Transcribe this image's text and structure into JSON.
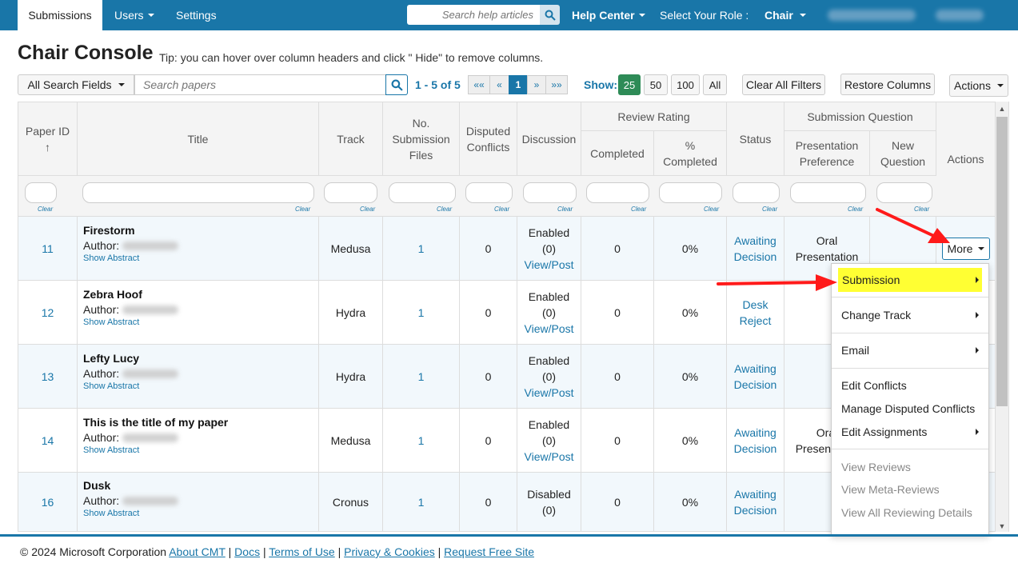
{
  "navbar": {
    "tabs": [
      "Submissions",
      "Users",
      "Settings"
    ],
    "help_search_placeholder": "Search help articles",
    "help_center": "Help Center",
    "role_label": "Select Your Role :",
    "role_value": "Chair"
  },
  "header": {
    "title": "Chair Console",
    "tip": "Tip: you can hover over column headers and click \" Hide\" to remove columns."
  },
  "toolbar": {
    "search_fields": "All Search Fields",
    "search_placeholder": "Search papers",
    "range": "1 - 5 of 5",
    "pager": [
      "««",
      "«",
      "1",
      "»",
      "»»"
    ],
    "show_label": "Show:",
    "show_options": [
      "25",
      "50",
      "100",
      "All"
    ],
    "clear_filters": "Clear All Filters",
    "restore_columns": "Restore Columns",
    "actions": "Actions"
  },
  "table": {
    "headers": {
      "paper_id": "Paper ID",
      "sort_indicator": "↑",
      "title": "Title",
      "track": "Track",
      "num_files": "No. Submission Files",
      "disputed": "Disputed Conflicts",
      "discussion": "Discussion",
      "review_rating": "Review Rating",
      "completed": "Completed",
      "pct_completed": "% Completed",
      "status": "Status",
      "submission_question": "Submission Question",
      "presentation_pref": "Presentation Preference",
      "new_question": "New Question",
      "actions": "Actions"
    },
    "clear_label": "Clear",
    "author_label": "Author:",
    "show_abstract": "Show Abstract",
    "view_post": "View/Post",
    "rows": [
      {
        "id": "11",
        "title": "Firestorm",
        "track": "Medusa",
        "files": "1",
        "disputed": "0",
        "discussion": "Enabled",
        "disc_count": "(0)",
        "completed": "0",
        "pct": "0%",
        "status": "Awaiting Decision",
        "pref": "Oral Presentation"
      },
      {
        "id": "12",
        "title": "Zebra Hoof",
        "track": "Hydra",
        "files": "1",
        "disputed": "0",
        "discussion": "Enabled",
        "disc_count": "(0)",
        "completed": "0",
        "pct": "0%",
        "status": "Desk Reject",
        "pref": ""
      },
      {
        "id": "13",
        "title": "Lefty Lucy",
        "track": "Hydra",
        "files": "1",
        "disputed": "0",
        "discussion": "Enabled",
        "disc_count": "(0)",
        "completed": "0",
        "pct": "0%",
        "status": "Awaiting Decision",
        "pref": ""
      },
      {
        "id": "14",
        "title": "This is the title of my paper",
        "track": "Medusa",
        "files": "1",
        "disputed": "0",
        "discussion": "Enabled",
        "disc_count": "(0)",
        "completed": "0",
        "pct": "0%",
        "status": "Awaiting Decision",
        "pref": "Oral Presentation"
      },
      {
        "id": "16",
        "title": "Dusk",
        "track": "Cronus",
        "files": "1",
        "disputed": "0",
        "discussion": "Disabled",
        "disc_count": "(0)",
        "completed": "0",
        "pct": "0%",
        "status": "Awaiting Decision",
        "pref": ""
      }
    ]
  },
  "more_button": "More",
  "dropdown": {
    "items": [
      {
        "label": "Submission",
        "submenu": true,
        "disabled": false
      },
      {
        "label": "Change Track",
        "submenu": true,
        "disabled": false
      },
      {
        "label": "Email",
        "submenu": true,
        "disabled": false
      },
      {
        "label": "Edit Conflicts",
        "submenu": false,
        "disabled": false
      },
      {
        "label": "Manage Disputed Conflicts",
        "submenu": false,
        "disabled": false
      },
      {
        "label": "Edit Assignments",
        "submenu": true,
        "disabled": false
      },
      {
        "label": "View Reviews",
        "submenu": false,
        "disabled": true
      },
      {
        "label": "View Meta-Reviews",
        "submenu": false,
        "disabled": true
      },
      {
        "label": "View All Reviewing Details",
        "submenu": false,
        "disabled": true
      }
    ]
  },
  "footer": {
    "copyright": "© 2024 Microsoft Corporation",
    "links": [
      "About CMT",
      "Docs",
      "Terms of Use",
      "Privacy & Cookies",
      "Request Free Site"
    ]
  },
  "colors": {
    "brand": "#1976a8",
    "highlight": "#ffff33",
    "annotation_arrow": "#ff1a1a",
    "show_active": "#2e8b57"
  }
}
